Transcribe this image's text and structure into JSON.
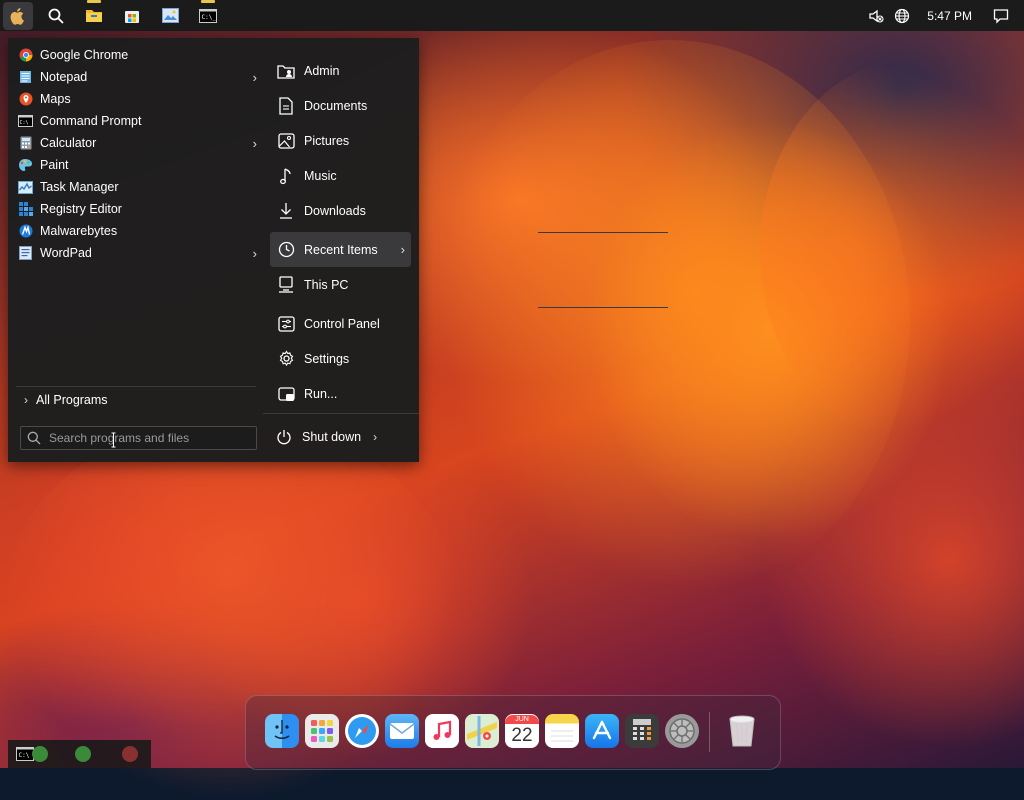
{
  "topbar": {
    "icons": [
      "apple-logo-icon",
      "search-icon",
      "file-explorer-icon",
      "store-icon",
      "photos-icon",
      "command-prompt-icon"
    ],
    "tray_icons": [
      "mute-icon",
      "globe-icon",
      "notification-icon"
    ],
    "time": "5:47 PM"
  },
  "start_menu": {
    "programs": [
      {
        "label": "Google Chrome",
        "icon": "chrome-icon",
        "submenu": false
      },
      {
        "label": "Notepad",
        "icon": "notepad-icon",
        "submenu": true
      },
      {
        "label": "Maps",
        "icon": "maps-icon",
        "submenu": false
      },
      {
        "label": "Command Prompt",
        "icon": "command-prompt-icon",
        "submenu": false
      },
      {
        "label": "Calculator",
        "icon": "calculator-icon",
        "submenu": true
      },
      {
        "label": "Paint",
        "icon": "paint-icon",
        "submenu": false
      },
      {
        "label": "Task Manager",
        "icon": "task-manager-icon",
        "submenu": false
      },
      {
        "label": "Registry Editor",
        "icon": "registry-editor-icon",
        "submenu": false
      },
      {
        "label": "Malwarebytes",
        "icon": "malwarebytes-icon",
        "submenu": false
      },
      {
        "label": "WordPad",
        "icon": "wordpad-icon",
        "submenu": true
      }
    ],
    "all_programs": "All Programs",
    "search_placeholder": "Search programs and files",
    "places": [
      {
        "label": "Admin",
        "icon": "user-folder-icon"
      },
      {
        "label": "Documents",
        "icon": "documents-icon"
      },
      {
        "label": "Pictures",
        "icon": "pictures-icon"
      },
      {
        "label": "Music",
        "icon": "music-icon"
      },
      {
        "label": "Downloads",
        "icon": "downloads-icon"
      },
      {
        "label": "Recent Items",
        "icon": "clock-icon",
        "submenu": true,
        "highlighted": true
      },
      {
        "label": "This PC",
        "icon": "computer-icon"
      },
      {
        "label": "Control Panel",
        "icon": "control-panel-icon"
      },
      {
        "label": "Settings",
        "icon": "gear-icon"
      },
      {
        "label": "Run...",
        "icon": "run-icon"
      }
    ],
    "shutdown": "Shut down"
  },
  "dock": {
    "apps": [
      {
        "name": "finder",
        "icon": "finder-icon"
      },
      {
        "name": "launchpad",
        "icon": "launchpad-icon"
      },
      {
        "name": "safari",
        "icon": "safari-icon"
      },
      {
        "name": "mail",
        "icon": "mail-icon"
      },
      {
        "name": "music",
        "icon": "music-app-icon"
      },
      {
        "name": "maps",
        "icon": "maps-app-icon"
      },
      {
        "name": "calendar",
        "icon": "calendar-icon",
        "month": "JUN",
        "day": "22"
      },
      {
        "name": "notes",
        "icon": "notes-icon"
      },
      {
        "name": "app-store",
        "icon": "app-store-icon"
      },
      {
        "name": "calculator",
        "icon": "calculator-app-icon"
      },
      {
        "name": "system-preferences",
        "icon": "system-preferences-icon"
      },
      {
        "name": "trash",
        "icon": "trash-icon"
      }
    ]
  },
  "colors": {
    "menu_bg": "#1e1e1f",
    "highlight": "#3a3a3c",
    "taskbar": "#1b1b1c"
  }
}
